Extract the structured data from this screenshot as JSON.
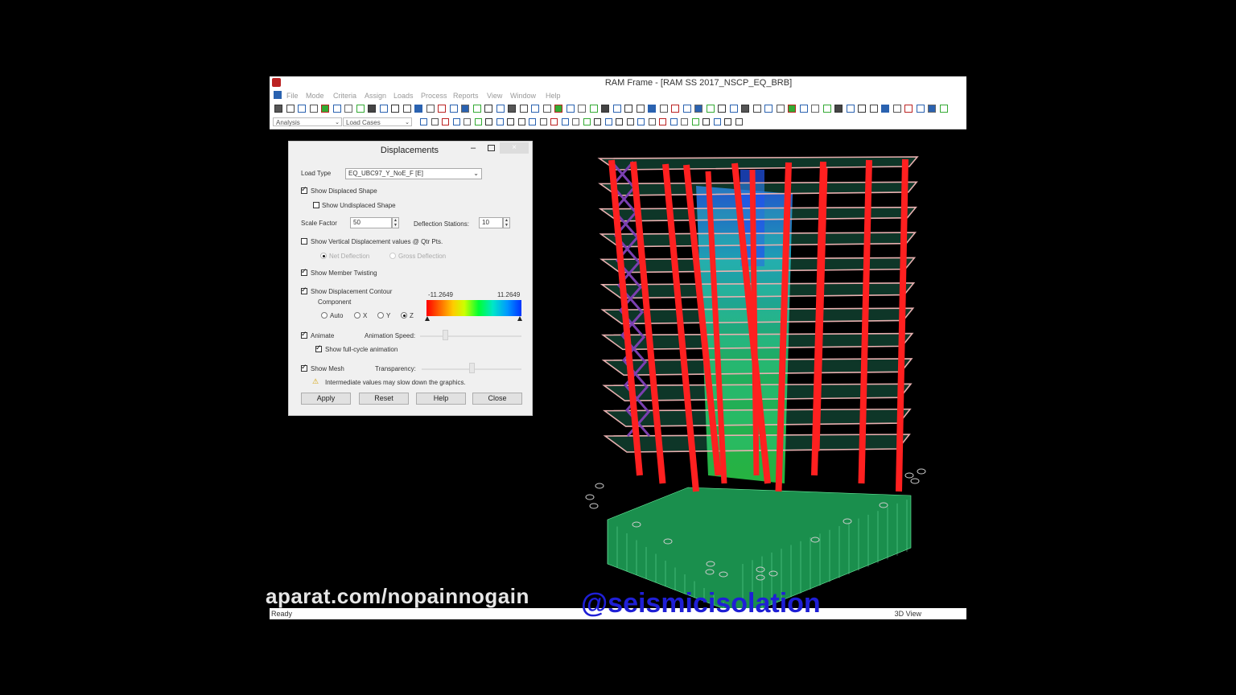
{
  "window": {
    "title": "RAM Frame - [RAM SS 2017_NSCP_EQ_BRB]",
    "menu": [
      "File",
      "Mode",
      "Criteria",
      "Assign",
      "Loads",
      "Process",
      "Reports",
      "View",
      "Window",
      "Help"
    ],
    "toolbar": {
      "analysis_combo": "Analysis",
      "load_cases_combo": "Load Cases"
    },
    "status": {
      "left": "Ready",
      "right": "3D View"
    }
  },
  "dialog": {
    "title": "Displacements",
    "close_glyph": "×",
    "minimize_glyph": "–",
    "load_type_label": "Load Type",
    "load_type_value": "EQ_UBC97_Y_NoE_F [E]",
    "show_displaced_shape": {
      "label": "Show Displaced Shape",
      "checked": true
    },
    "show_undisplaced_shape": {
      "label": "Show Undisplaced Shape",
      "checked": false
    },
    "scale_factor_label": "Scale Factor",
    "scale_factor_value": "50",
    "deflection_stations_label": "Deflection Stations:",
    "deflection_stations_value": "10",
    "show_vertical": {
      "label": "Show Vertical Displacement values @ Qtr Pts.",
      "checked": false
    },
    "net_deflection": "Net Deflection",
    "gross_deflection": "Gross Deflection",
    "show_member_twisting": {
      "label": "Show Member Twisting",
      "checked": true
    },
    "show_contour": {
      "label": "Show Displacement Contour",
      "checked": true
    },
    "component_label": "Component",
    "component_options": [
      "Auto",
      "X",
      "Y",
      "Z"
    ],
    "component_selected": "Z",
    "contour_min": "-11.2649",
    "contour_max": "11.2649",
    "animate": {
      "label": "Animate",
      "checked": true
    },
    "animation_speed_label": "Animation Speed:",
    "show_full_cycle": {
      "label": "Show full-cycle animation",
      "checked": true
    },
    "show_mesh": {
      "label": "Show Mesh",
      "checked": true
    },
    "transparency_label": "Transparency:",
    "warning_text": "Intermediate values may slow down the graphics.",
    "buttons": {
      "apply": "Apply",
      "reset": "Reset",
      "help": "Help",
      "close": "Close"
    }
  },
  "overlay": {
    "watermark_left": "aparat.com/nopainnogain",
    "watermark_right": "@seismicisolation"
  },
  "colors": {
    "column": "#ff2020",
    "brace": "#7a3fb0",
    "slab_edge": "#d9a4a4",
    "mesh": "#2fd08a",
    "watermark_blue": "#1f1fd6"
  }
}
